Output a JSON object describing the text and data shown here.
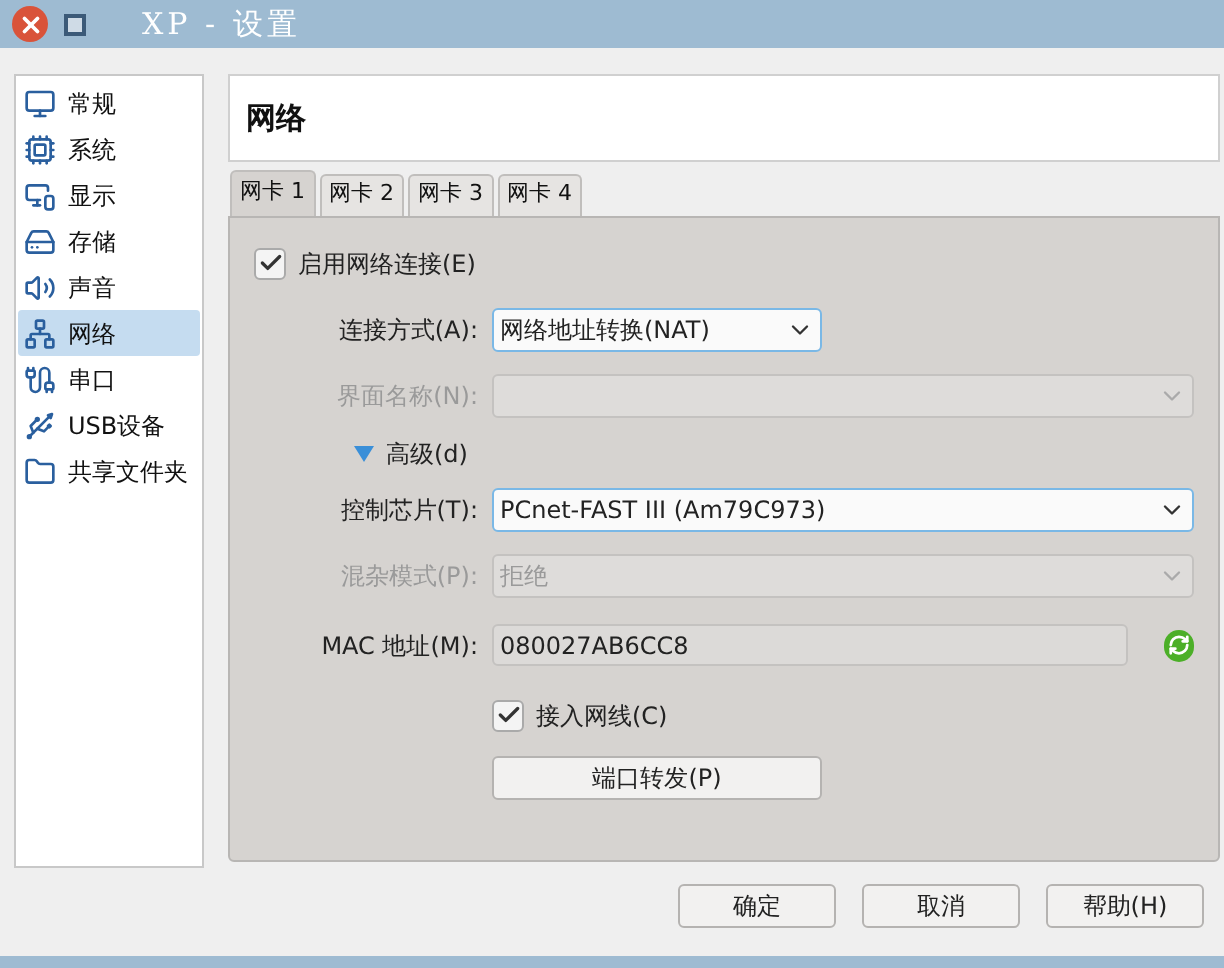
{
  "window": {
    "title": "XP - 设置"
  },
  "sidebar": {
    "items": [
      {
        "label": "常规",
        "selected": false
      },
      {
        "label": "系统",
        "selected": false
      },
      {
        "label": "显示",
        "selected": false
      },
      {
        "label": "存储",
        "selected": false
      },
      {
        "label": "声音",
        "selected": false
      },
      {
        "label": "网络",
        "selected": true
      },
      {
        "label": "串口",
        "selected": false
      },
      {
        "label": "USB设备",
        "selected": false
      },
      {
        "label": "共享文件夹",
        "selected": false
      }
    ]
  },
  "page_title": "网络",
  "tabs": [
    {
      "label": "网卡 1",
      "selected": true
    },
    {
      "label": "网卡 2",
      "selected": false
    },
    {
      "label": "网卡 3",
      "selected": false
    },
    {
      "label": "网卡 4",
      "selected": false
    }
  ],
  "form": [
    {
      "kind": "checkbox",
      "label": "启用网络连接(E)",
      "checked": true
    },
    {
      "kind": "select",
      "label": "连接方式(A):",
      "value": "网络地址转换(NAT)",
      "disabled": false
    },
    {
      "kind": "select",
      "label": "界面名称(N):",
      "disabled": true
    },
    {
      "kind": "expander",
      "label": "高级(d)",
      "expanded": true
    },
    {
      "kind": "select",
      "label": "控制芯片(T):",
      "value": "PCnet-FAST III (Am79C973)",
      "disabled": false
    },
    {
      "kind": "select",
      "label": "混杂模式(P):",
      "value": "拒绝",
      "disabled": true
    },
    {
      "kind": "text",
      "label": "MAC 地址(M):",
      "value": "080027AB6CC8"
    },
    {
      "kind": "checkbox",
      "label": "接入网线(C)",
      "checked": true
    },
    {
      "kind": "button",
      "label": "端口转发(P)"
    }
  ],
  "buttons": [
    "确定",
    "取消",
    "帮助(H)"
  ]
}
